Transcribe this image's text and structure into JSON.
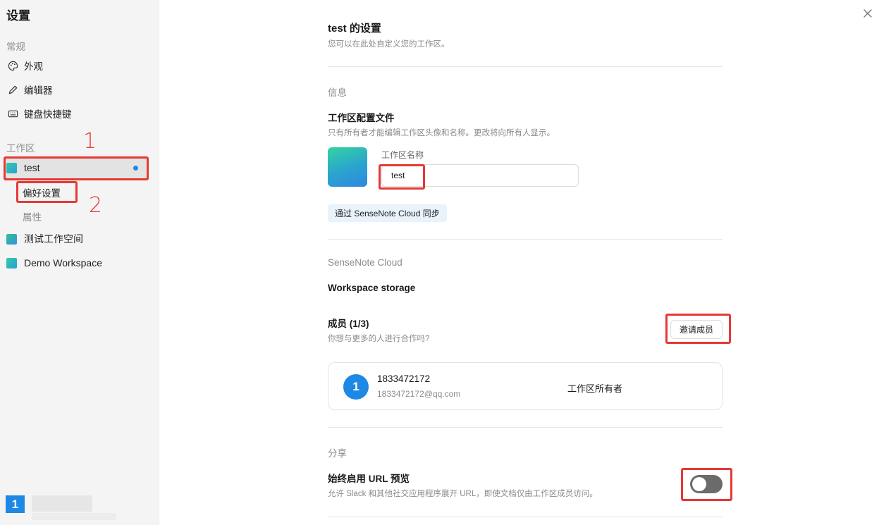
{
  "sidebar": {
    "title": "设置",
    "general_label": "常规",
    "general_items": [
      {
        "label": "外观",
        "icon": "palette-icon"
      },
      {
        "label": "编辑器",
        "icon": "pencil-icon"
      },
      {
        "label": "键盘快捷键",
        "icon": "keyboard-icon"
      }
    ],
    "workspace_label": "工作区",
    "workspaces": [
      {
        "name": "test",
        "active": true,
        "has_unread_dot": true
      },
      {
        "name": "测试工作空间",
        "active": false
      },
      {
        "name": "Demo Workspace",
        "active": false
      }
    ],
    "sub_items": [
      "偏好设置",
      "属性"
    ],
    "user_avatar": "1"
  },
  "annotations": {
    "label_1": "1",
    "label_2": "2",
    "highlight_color": "#e53935"
  },
  "main": {
    "title": "test 的设置",
    "subtitle": "您可以在此处自定义您的工作区。",
    "info_section": "信息",
    "profile_title": "工作区配置文件",
    "profile_desc": "只有所有者才能编辑工作区头像和名称。更改将向所有人显示。",
    "name_label": "工作区名称",
    "name_value": "test",
    "sync_badge": "通过 SenseNote Cloud 同步",
    "cloud_section": "SenseNote Cloud",
    "storage_title": "Workspace storage",
    "members_title": "成员 (1/3)",
    "members_desc": "你想与更多的人进行合作吗?",
    "invite_button": "邀请成员",
    "member": {
      "avatar": "1",
      "name": "1833472172",
      "email": "1833472172@qq.com",
      "role": "工作区所有者"
    },
    "share_section": "分享",
    "url_preview_title": "始终启用 URL 预览",
    "url_preview_desc": "允许 Slack 和其他社交应用程序展开 URL，即使文档仅由工作区成员访问。",
    "url_preview_enabled": false
  },
  "colors": {
    "accent": "#1e88e5",
    "sidebar_bg": "#f4f4f4",
    "toggle_off": "#6b6b6b"
  }
}
